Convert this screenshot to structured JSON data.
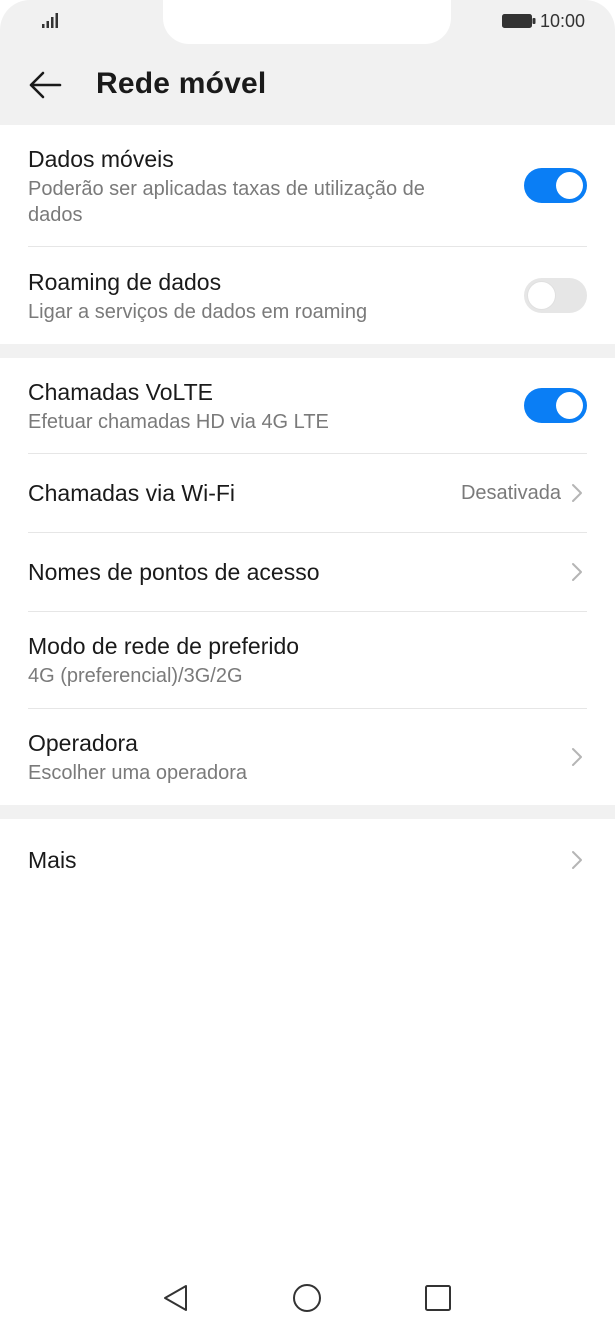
{
  "status_bar": {
    "time": "10:00",
    "signal_icon": "signal-icon",
    "battery_icon": "battery-icon"
  },
  "header": {
    "title": "Rede móvel",
    "back_icon": "back-arrow-icon"
  },
  "sections": [
    {
      "rows": [
        {
          "label": "Dados móveis",
          "sublabel": "Poderão ser aplicadas taxas de utilização de dados",
          "toggle": true
        },
        {
          "label": "Roaming de dados",
          "sublabel": "Ligar a serviços de dados em roaming",
          "toggle": false
        }
      ]
    },
    {
      "rows": [
        {
          "label": "Chamadas VoLTE",
          "sublabel": "Efetuar chamadas HD via 4G LTE",
          "toggle": true
        },
        {
          "label": "Chamadas via Wi-Fi",
          "value": "Desativada"
        },
        {
          "label": "Nomes de pontos de acesso"
        },
        {
          "label": "Modo de rede de preferido",
          "sublabel": "4G (preferencial)/3G/2G"
        },
        {
          "label": "Operadora",
          "sublabel": "Escolher uma operadora"
        }
      ]
    },
    {
      "rows": [
        {
          "label": "Mais"
        }
      ]
    }
  ],
  "colors": {
    "accent": "#0a7ef5",
    "header_bg": "#f1f1f1",
    "secondary_text": "#7a7a7a"
  },
  "nav_bar": [
    "back-triangle-icon",
    "home-circle-icon",
    "recents-square-icon"
  ]
}
